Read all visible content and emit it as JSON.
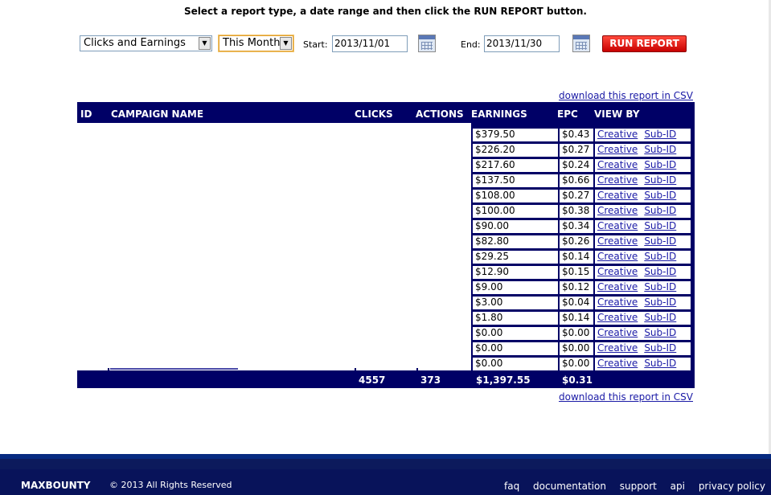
{
  "instructions": "Select a report type, a date range and then click the RUN REPORT button.",
  "controls": {
    "report_type": "Clicks and Earnings",
    "date_range": "This Month",
    "start_label": "Start:",
    "start_value": "2013/11/01",
    "end_label": "End:",
    "end_value": "2013/11/30",
    "run_button": "RUN REPORT",
    "calendar_icon": "calendar-icon",
    "dropdown_icon": "chevron-down-icon"
  },
  "csv_link": "download this report in CSV",
  "table": {
    "headers": {
      "id": "ID",
      "campaign": "CAMPAIGN NAME",
      "clicks": "CLICKS",
      "actions": "ACTIONS",
      "earnings": "EARNINGS",
      "epc": "EPC",
      "viewby": "VIEW BY"
    },
    "rows": [
      {
        "earnings": "$379.50",
        "epc": "$0.43",
        "creative": "Creative",
        "subid": "Sub-ID"
      },
      {
        "earnings": "$226.20",
        "epc": "$0.27",
        "creative": "Creative",
        "subid": "Sub-ID"
      },
      {
        "earnings": "$217.60",
        "epc": "$0.24",
        "creative": "Creative",
        "subid": "Sub-ID"
      },
      {
        "earnings": "$137.50",
        "epc": "$0.66",
        "creative": "Creative",
        "subid": "Sub-ID"
      },
      {
        "earnings": "$108.00",
        "epc": "$0.27",
        "creative": "Creative",
        "subid": "Sub-ID"
      },
      {
        "earnings": "$100.00",
        "epc": "$0.38",
        "creative": "Creative",
        "subid": "Sub-ID"
      },
      {
        "earnings": "$90.00",
        "epc": "$0.34",
        "creative": "Creative",
        "subid": "Sub-ID"
      },
      {
        "earnings": "$82.80",
        "epc": "$0.26",
        "creative": "Creative",
        "subid": "Sub-ID"
      },
      {
        "earnings": "$29.25",
        "epc": "$0.14",
        "creative": "Creative",
        "subid": "Sub-ID"
      },
      {
        "earnings": "$12.90",
        "epc": "$0.15",
        "creative": "Creative",
        "subid": "Sub-ID"
      },
      {
        "earnings": "$9.00",
        "epc": "$0.12",
        "creative": "Creative",
        "subid": "Sub-ID"
      },
      {
        "earnings": "$3.00",
        "epc": "$0.04",
        "creative": "Creative",
        "subid": "Sub-ID"
      },
      {
        "earnings": "$1.80",
        "epc": "$0.14",
        "creative": "Creative",
        "subid": "Sub-ID"
      },
      {
        "earnings": "$0.00",
        "epc": "$0.00",
        "creative": "Creative",
        "subid": "Sub-ID"
      },
      {
        "earnings": "$0.00",
        "epc": "$0.00",
        "creative": "Creative",
        "subid": "Sub-ID"
      },
      {
        "earnings": "$0.00",
        "epc": "$0.00",
        "creative": "Creative",
        "subid": "Sub-ID"
      }
    ],
    "totals": {
      "clicks": "4557",
      "actions": "373",
      "earnings": "$1,397.55",
      "epc": "$0.31"
    }
  },
  "footer": {
    "logo": "MAXBOUNTY",
    "copyright": "© 2013 All Rights Reserved",
    "links": [
      "faq",
      "documentation",
      "support",
      "api",
      "privacy policy"
    ]
  },
  "colors": {
    "table_header": "#000066",
    "run_button": "#e01010",
    "link": "#1a1aa6",
    "footer": "#08135a"
  }
}
